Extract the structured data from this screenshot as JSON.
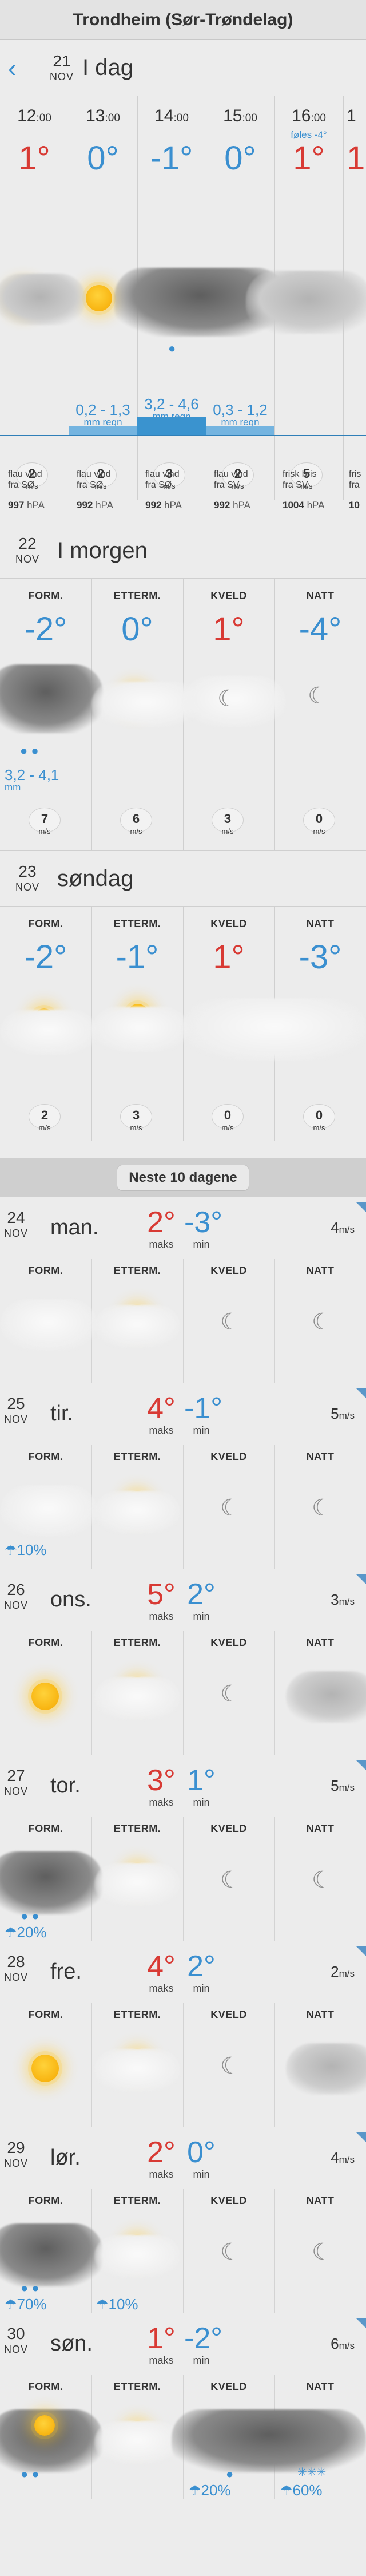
{
  "app": {
    "title": "Trondheim (Sør-Trøndelag)"
  },
  "today": {
    "day": "21",
    "month": "NOV",
    "name": "I dag",
    "hours": [
      {
        "time": "12",
        "min": ":00",
        "temp": "1°",
        "tclass": "warm",
        "wind_dir": "flau vind",
        "wind_from": "fra SØ",
        "wind": "2",
        "pressure": "997",
        "unit": "hPA",
        "rain": ""
      },
      {
        "time": "13",
        "min": ":00",
        "temp": "0°",
        "tclass": "cold",
        "wind_dir": "flau vind",
        "wind_from": "fra SØ",
        "wind": "2",
        "pressure": "992",
        "unit": "hPA",
        "rain": "0,2 - 1,3",
        "rain_unit": "mm regn"
      },
      {
        "time": "14",
        "min": ":00",
        "temp": "-1°",
        "tclass": "cold",
        "wind_dir": "flau vind",
        "wind_from": "fra SØ",
        "wind": "3",
        "pressure": "992",
        "unit": "hPA",
        "rain": "3,2 - 4,6",
        "rain_unit": "mm regn"
      },
      {
        "time": "15",
        "min": ":00",
        "temp": "0°",
        "tclass": "cold",
        "wind_dir": "flau vind",
        "wind_from": "fra SV",
        "wind": "2",
        "pressure": "992",
        "unit": "hPA",
        "rain": "0,3 - 1,2",
        "rain_unit": "mm regn"
      },
      {
        "time": "16",
        "min": ":00",
        "temp": "1°",
        "tclass": "warm",
        "sub": "føles -4°",
        "wind_dir": "frisk bris",
        "wind_from": "fra SV",
        "wind": "5",
        "pressure": "1004",
        "unit": "hPA",
        "rain": ""
      },
      {
        "time": "1",
        "min": "",
        "temp": "1",
        "tclass": "warm",
        "wind_dir": "fris",
        "wind_from": "fra",
        "wind": "",
        "pressure": "10",
        "unit": "",
        "rain": ""
      }
    ]
  },
  "ms": "m/s",
  "periods": {
    "a": "FORM.",
    "b": "ETTERM.",
    "c": "KVELD",
    "d": "NATT"
  },
  "tomorrow": {
    "day": "22",
    "month": "NOV",
    "name": "I morgen",
    "temps": [
      "-2°",
      "0°",
      "1°",
      "-4°"
    ],
    "rain": "3,2 - 4,1",
    "rain_unit": "mm",
    "winds": [
      "7",
      "6",
      "3",
      "0"
    ]
  },
  "sunday": {
    "day": "23",
    "month": "NOV",
    "name": "søndag",
    "temps": [
      "-2°",
      "-1°",
      "1°",
      "-3°"
    ],
    "winds": [
      "2",
      "3",
      "0",
      "0"
    ]
  },
  "next10": "Neste 10 dagene",
  "days": [
    {
      "day": "24",
      "month": "NOV",
      "name": "man.",
      "max": "2°",
      "min": "-3°",
      "max_l": "maks",
      "min_l": "min",
      "wind": "4",
      "precip": ""
    },
    {
      "day": "25",
      "month": "NOV",
      "name": "tir.",
      "max": "4°",
      "min": "-1°",
      "max_l": "maks",
      "min_l": "min",
      "wind": "5",
      "precip": "10%"
    },
    {
      "day": "26",
      "month": "NOV",
      "name": "ons.",
      "max": "5°",
      "min": "2°",
      "max_l": "maks",
      "min_l": "min",
      "wind": "3",
      "precip": ""
    },
    {
      "day": "27",
      "month": "NOV",
      "name": "tor.",
      "max": "3°",
      "min": "1°",
      "max_l": "maks",
      "min_l": "min",
      "wind": "5",
      "precip": "20%"
    },
    {
      "day": "28",
      "month": "NOV",
      "name": "fre.",
      "max": "4°",
      "min": "2°",
      "max_l": "maks",
      "min_l": "min",
      "wind": "2",
      "precip": ""
    },
    {
      "day": "29",
      "month": "NOV",
      "name": "lør.",
      "max": "2°",
      "min": "0°",
      "max_l": "maks",
      "min_l": "min",
      "wind": "4",
      "precip": "70%",
      "precip2": "10%"
    },
    {
      "day": "30",
      "month": "NOV",
      "name": "søn.",
      "max": "1°",
      "min": "-2°",
      "max_l": "maks",
      "min_l": "min",
      "wind": "6",
      "precip": "20%",
      "precip2": "60%"
    }
  ]
}
